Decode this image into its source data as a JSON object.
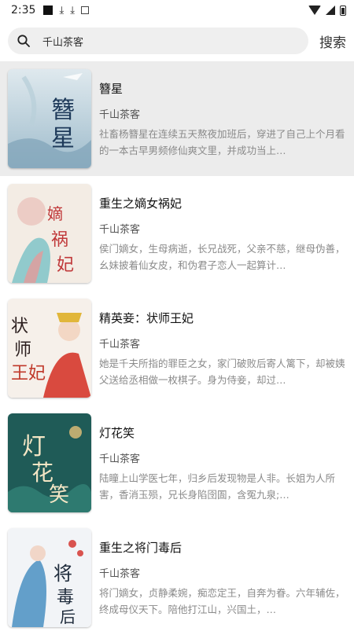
{
  "status_bar": {
    "time": "2:35"
  },
  "search": {
    "query": "千山茶客",
    "button_label": "搜索"
  },
  "books": [
    {
      "title": "簪星",
      "author": "千山茶客",
      "desc": "社畜杨簪星在连续五天熬夜加班后，穿进了自己上个月看的一本古早男频修仙爽文里，并成功当上…"
    },
    {
      "title": "重生之嫡女祸妃",
      "author": "千山茶客",
      "desc": "侯门嫡女，生母病逝，长兄战死，父亲不慈，继母伪善，幺妹披着仙女皮，和伪君子恋人一起算计…"
    },
    {
      "title": "精英妾：状师王妃",
      "author": "千山茶客",
      "desc": "她是千夫所指的罪臣之女，家门破败后寄人篱下，却被姨父送给丞相做一枚棋子。身为侍妾，却过…"
    },
    {
      "title": "灯花笑",
      "author": "千山茶客",
      "desc": "陆瞳上山学医七年，归乡后发现物是人非。长姐为人所害，香消玉殒，兄长身陷囹圄，含冤九泉;…"
    },
    {
      "title": "重生之将门毒后",
      "author": "千山茶客",
      "desc": "将门嫡女，贞静柔婉，痴恋定王，自奔为眷。六年辅佐，终成母仪天下。陪他打江山，兴国土，…"
    }
  ]
}
